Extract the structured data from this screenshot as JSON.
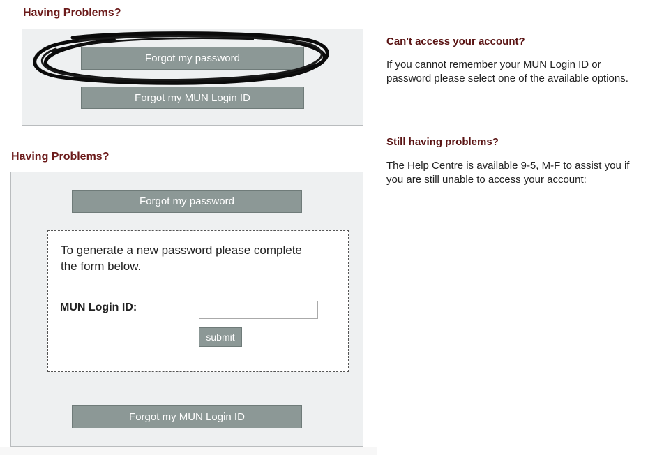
{
  "top_section": {
    "heading": "Having Problems?",
    "forgot_password_label": "Forgot my password",
    "forgot_login_id_label": "Forgot my MUN Login ID"
  },
  "bottom_section": {
    "heading": "Having Problems?",
    "forgot_password_label": "Forgot my password",
    "form": {
      "instructions": "To generate a new password please complete the form below.",
      "login_id_label": "MUN Login ID:",
      "login_id_value": "",
      "submit_label": "submit"
    },
    "forgot_login_id_label": "Forgot my MUN Login ID"
  },
  "sidebar": {
    "access_title": "Can't access your account?",
    "access_text": "If you cannot remember your MUN Login ID or password please select one of the available options.",
    "help_title": "Still having problems?",
    "help_text": "The Help Centre is available 9-5, M-F to assist you if you are still unable to access your account:"
  },
  "colors": {
    "heading": "#6b1a1a",
    "button": "#8c9896",
    "panel": "#eef0f1"
  }
}
